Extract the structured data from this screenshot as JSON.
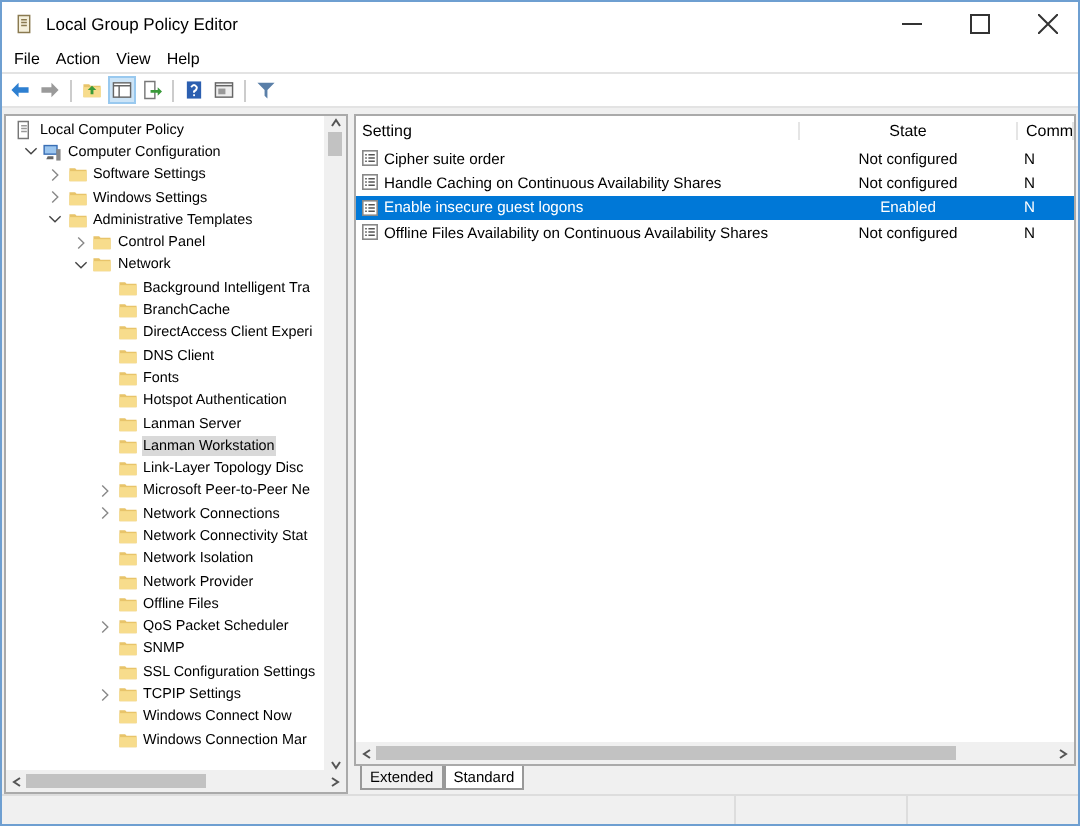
{
  "window": {
    "title": "Local Group Policy Editor"
  },
  "menu": [
    "File",
    "Action",
    "View",
    "Help"
  ],
  "toolbar": [
    {
      "kind": "back",
      "pressed": false
    },
    {
      "kind": "forward",
      "pressed": false
    },
    {
      "kind": "up",
      "pressed": false
    },
    {
      "kind": "tree",
      "pressed": true
    },
    {
      "kind": "export",
      "pressed": false
    },
    {
      "kind": "help",
      "pressed": false
    },
    {
      "kind": "view",
      "pressed": false
    },
    {
      "kind": "filter",
      "pressed": false
    }
  ],
  "tree": [
    {
      "label": "Local Computer Policy",
      "kind": "policy",
      "selected": false,
      "children": [
        {
          "label": "Computer Configuration",
          "kind": "computer",
          "expanded": true,
          "selected": false,
          "children": [
            {
              "label": "Software Settings",
              "kind": "folder",
              "expanded": false,
              "selected": false
            },
            {
              "label": "Windows Settings",
              "kind": "folder",
              "expanded": false,
              "selected": false
            },
            {
              "label": "Administrative Templates",
              "kind": "folder",
              "expanded": true,
              "selected": false,
              "children": [
                {
                  "label": "Control Panel",
                  "kind": "folder",
                  "expanded": false,
                  "selected": false
                },
                {
                  "label": "Network",
                  "kind": "folder",
                  "expanded": true,
                  "selected": false,
                  "children": [
                    {
                      "label": "Background Intelligent Tra",
                      "kind": "folder",
                      "selected": false
                    },
                    {
                      "label": "BranchCache",
                      "kind": "folder",
                      "selected": false
                    },
                    {
                      "label": "DirectAccess Client Experi",
                      "kind": "folder",
                      "selected": false
                    },
                    {
                      "label": "DNS Client",
                      "kind": "folder",
                      "selected": false
                    },
                    {
                      "label": "Fonts",
                      "kind": "folder",
                      "selected": false
                    },
                    {
                      "label": "Hotspot Authentication",
                      "kind": "folder",
                      "selected": false
                    },
                    {
                      "label": "Lanman Server",
                      "kind": "folder",
                      "selected": false
                    },
                    {
                      "label": "Lanman Workstation",
                      "kind": "folder",
                      "selected": true
                    },
                    {
                      "label": "Link-Layer Topology Disc",
                      "kind": "folder",
                      "selected": false
                    },
                    {
                      "label": "Microsoft Peer-to-Peer Ne",
                      "kind": "folder",
                      "expanded": false,
                      "selected": false
                    },
                    {
                      "label": "Network Connections",
                      "kind": "folder",
                      "expanded": false,
                      "selected": false
                    },
                    {
                      "label": "Network Connectivity Stat",
                      "kind": "folder",
                      "selected": false
                    },
                    {
                      "label": "Network Isolation",
                      "kind": "folder",
                      "selected": false
                    },
                    {
                      "label": "Network Provider",
                      "kind": "folder",
                      "selected": false
                    },
                    {
                      "label": "Offline Files",
                      "kind": "folder",
                      "selected": false
                    },
                    {
                      "label": "QoS Packet Scheduler",
                      "kind": "folder",
                      "expanded": false,
                      "selected": false
                    },
                    {
                      "label": "SNMP",
                      "kind": "folder",
                      "selected": false
                    },
                    {
                      "label": "SSL Configuration Settings",
                      "kind": "folder",
                      "selected": false
                    },
                    {
                      "label": "TCPIP Settings",
                      "kind": "folder",
                      "expanded": false,
                      "selected": false
                    },
                    {
                      "label": "Windows Connect Now",
                      "kind": "folder",
                      "selected": false
                    },
                    {
                      "label": "Windows Connection Mar",
                      "kind": "folder",
                      "selected": false
                    }
                  ]
                }
              ]
            }
          ]
        }
      ]
    }
  ],
  "table": {
    "columns": [
      "Setting",
      "State",
      "Comm"
    ],
    "rows": [
      {
        "setting": "Cipher suite order",
        "state": "Not configured",
        "comment": "N",
        "selected": false
      },
      {
        "setting": "Handle Caching on Continuous Availability Shares",
        "state": "Not configured",
        "comment": "N",
        "selected": false
      },
      {
        "setting": "Enable insecure guest logons",
        "state": "Enabled",
        "comment": "N",
        "selected": true
      },
      {
        "setting": "Offline Files Availability on Continuous Availability Shares",
        "state": "Not configured",
        "comment": "N",
        "selected": false
      }
    ]
  },
  "tabs": [
    {
      "label": "Extended",
      "selected": false
    },
    {
      "label": "Standard",
      "selected": true
    }
  ]
}
